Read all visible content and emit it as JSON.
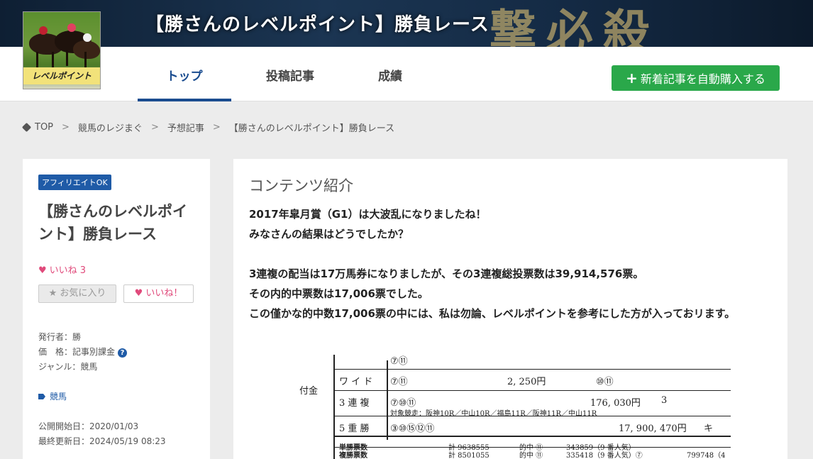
{
  "banner": {
    "title": "【勝さんのレベルポイント】勝負レース",
    "deco_text": "撃必殺"
  },
  "logo": {
    "label": "レベルポイント"
  },
  "nav": {
    "tabs": [
      {
        "label": "トップ"
      },
      {
        "label": "投稿記事"
      },
      {
        "label": "成績"
      }
    ],
    "buy_button": "新着記事を自動購入する",
    "buy_plus": "+"
  },
  "breadcrumb": [
    "TOP",
    "競馬のレジまぐ",
    "予想記事",
    "【勝さんのレベルポイント】勝負レース"
  ],
  "breadcrumb_sep": ">",
  "sidebar": {
    "badge": "アフィリエイトOK",
    "title": "【勝さんのレベルポイント】勝負レース",
    "like_count": "いいね 3",
    "fav_button": "お気に入り",
    "like_button": "いいね！",
    "publisher": "発行者：勝",
    "price": "価　格：記事別課金",
    "help": "?",
    "genre": "ジャンル：競馬",
    "tag": "競馬",
    "published": "公開開始日：2020/01/03",
    "updated": "最終更新日：2024/05/19 08:23"
  },
  "main": {
    "heading": "コンテンツ紹介",
    "paragraphs": [
      "2017年皐月賞（G1）は大波乱になりましたね！",
      "みなさんの結果はどうでしたか？",
      "",
      "3連複の配当は17万馬券になりましたが、その3連複総投票数は39,914,576票。",
      "その内的中票数は17,006票でした。",
      "この僅かな的中数17,006票の中には、私は勿論、レベルポイントを参考にした方が入っておリます。"
    ]
  },
  "scan": {
    "top_cell": "⑦⑪",
    "side_label": "付金",
    "rows": [
      {
        "type": "ワ イ ド",
        "combo": "⑦⑪",
        "amount": "2, 250円",
        "extra": "⑩⑪"
      },
      {
        "type": "3 連 複",
        "combo": "⑦⑩⑪",
        "amount": "176, 030円",
        "extra": "3"
      },
      {
        "type": "5 重 勝",
        "combo": "③⑩⑮⑫⑪",
        "amount": "17, 900, 470円",
        "extra": "キ"
      }
    ],
    "target_races": "対象競走：阪神10R／中山10R／福島11R／阪神11R／中山11R",
    "win_votes": {
      "label": "単勝票数",
      "total": "計 9638555",
      "hit": "的中 ⑪",
      "value": "343859（9 番人気）"
    },
    "place_votes": {
      "label": "複勝票数",
      "total": "計 8501055",
      "hit": "的中 ⑪",
      "value": "335418（9 番人気）⑦",
      "extra": "799748（4"
    }
  }
}
